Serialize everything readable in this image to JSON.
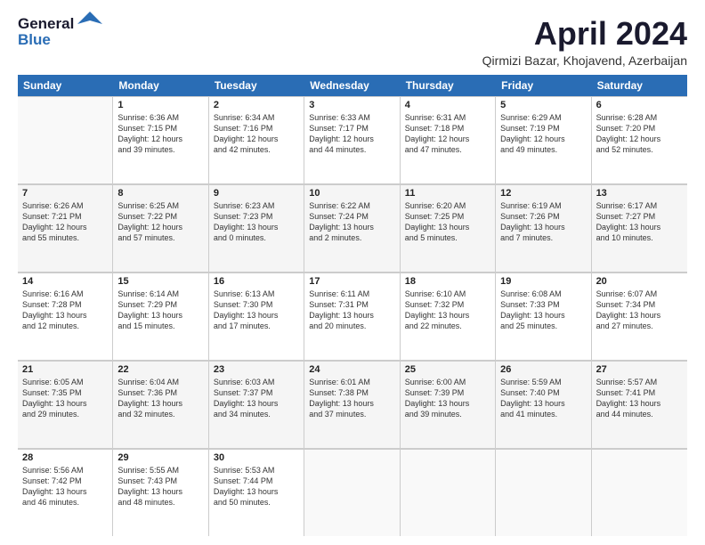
{
  "logo": {
    "line1": "General",
    "line2": "Blue"
  },
  "title": "April 2024",
  "location": "Qirmizi Bazar, Khojavend, Azerbaijan",
  "weekdays": [
    "Sunday",
    "Monday",
    "Tuesday",
    "Wednesday",
    "Thursday",
    "Friday",
    "Saturday"
  ],
  "rows": [
    [
      {
        "day": "",
        "lines": [],
        "empty": true
      },
      {
        "day": "1",
        "lines": [
          "Sunrise: 6:36 AM",
          "Sunset: 7:15 PM",
          "Daylight: 12 hours",
          "and 39 minutes."
        ]
      },
      {
        "day": "2",
        "lines": [
          "Sunrise: 6:34 AM",
          "Sunset: 7:16 PM",
          "Daylight: 12 hours",
          "and 42 minutes."
        ]
      },
      {
        "day": "3",
        "lines": [
          "Sunrise: 6:33 AM",
          "Sunset: 7:17 PM",
          "Daylight: 12 hours",
          "and 44 minutes."
        ]
      },
      {
        "day": "4",
        "lines": [
          "Sunrise: 6:31 AM",
          "Sunset: 7:18 PM",
          "Daylight: 12 hours",
          "and 47 minutes."
        ]
      },
      {
        "day": "5",
        "lines": [
          "Sunrise: 6:29 AM",
          "Sunset: 7:19 PM",
          "Daylight: 12 hours",
          "and 49 minutes."
        ]
      },
      {
        "day": "6",
        "lines": [
          "Sunrise: 6:28 AM",
          "Sunset: 7:20 PM",
          "Daylight: 12 hours",
          "and 52 minutes."
        ]
      }
    ],
    [
      {
        "day": "7",
        "lines": [
          "Sunrise: 6:26 AM",
          "Sunset: 7:21 PM",
          "Daylight: 12 hours",
          "and 55 minutes."
        ]
      },
      {
        "day": "8",
        "lines": [
          "Sunrise: 6:25 AM",
          "Sunset: 7:22 PM",
          "Daylight: 12 hours",
          "and 57 minutes."
        ]
      },
      {
        "day": "9",
        "lines": [
          "Sunrise: 6:23 AM",
          "Sunset: 7:23 PM",
          "Daylight: 13 hours",
          "and 0 minutes."
        ]
      },
      {
        "day": "10",
        "lines": [
          "Sunrise: 6:22 AM",
          "Sunset: 7:24 PM",
          "Daylight: 13 hours",
          "and 2 minutes."
        ]
      },
      {
        "day": "11",
        "lines": [
          "Sunrise: 6:20 AM",
          "Sunset: 7:25 PM",
          "Daylight: 13 hours",
          "and 5 minutes."
        ]
      },
      {
        "day": "12",
        "lines": [
          "Sunrise: 6:19 AM",
          "Sunset: 7:26 PM",
          "Daylight: 13 hours",
          "and 7 minutes."
        ]
      },
      {
        "day": "13",
        "lines": [
          "Sunrise: 6:17 AM",
          "Sunset: 7:27 PM",
          "Daylight: 13 hours",
          "and 10 minutes."
        ]
      }
    ],
    [
      {
        "day": "14",
        "lines": [
          "Sunrise: 6:16 AM",
          "Sunset: 7:28 PM",
          "Daylight: 13 hours",
          "and 12 minutes."
        ]
      },
      {
        "day": "15",
        "lines": [
          "Sunrise: 6:14 AM",
          "Sunset: 7:29 PM",
          "Daylight: 13 hours",
          "and 15 minutes."
        ]
      },
      {
        "day": "16",
        "lines": [
          "Sunrise: 6:13 AM",
          "Sunset: 7:30 PM",
          "Daylight: 13 hours",
          "and 17 minutes."
        ]
      },
      {
        "day": "17",
        "lines": [
          "Sunrise: 6:11 AM",
          "Sunset: 7:31 PM",
          "Daylight: 13 hours",
          "and 20 minutes."
        ]
      },
      {
        "day": "18",
        "lines": [
          "Sunrise: 6:10 AM",
          "Sunset: 7:32 PM",
          "Daylight: 13 hours",
          "and 22 minutes."
        ]
      },
      {
        "day": "19",
        "lines": [
          "Sunrise: 6:08 AM",
          "Sunset: 7:33 PM",
          "Daylight: 13 hours",
          "and 25 minutes."
        ]
      },
      {
        "day": "20",
        "lines": [
          "Sunrise: 6:07 AM",
          "Sunset: 7:34 PM",
          "Daylight: 13 hours",
          "and 27 minutes."
        ]
      }
    ],
    [
      {
        "day": "21",
        "lines": [
          "Sunrise: 6:05 AM",
          "Sunset: 7:35 PM",
          "Daylight: 13 hours",
          "and 29 minutes."
        ]
      },
      {
        "day": "22",
        "lines": [
          "Sunrise: 6:04 AM",
          "Sunset: 7:36 PM",
          "Daylight: 13 hours",
          "and 32 minutes."
        ]
      },
      {
        "day": "23",
        "lines": [
          "Sunrise: 6:03 AM",
          "Sunset: 7:37 PM",
          "Daylight: 13 hours",
          "and 34 minutes."
        ]
      },
      {
        "day": "24",
        "lines": [
          "Sunrise: 6:01 AM",
          "Sunset: 7:38 PM",
          "Daylight: 13 hours",
          "and 37 minutes."
        ]
      },
      {
        "day": "25",
        "lines": [
          "Sunrise: 6:00 AM",
          "Sunset: 7:39 PM",
          "Daylight: 13 hours",
          "and 39 minutes."
        ]
      },
      {
        "day": "26",
        "lines": [
          "Sunrise: 5:59 AM",
          "Sunset: 7:40 PM",
          "Daylight: 13 hours",
          "and 41 minutes."
        ]
      },
      {
        "day": "27",
        "lines": [
          "Sunrise: 5:57 AM",
          "Sunset: 7:41 PM",
          "Daylight: 13 hours",
          "and 44 minutes."
        ]
      }
    ],
    [
      {
        "day": "28",
        "lines": [
          "Sunrise: 5:56 AM",
          "Sunset: 7:42 PM",
          "Daylight: 13 hours",
          "and 46 minutes."
        ]
      },
      {
        "day": "29",
        "lines": [
          "Sunrise: 5:55 AM",
          "Sunset: 7:43 PM",
          "Daylight: 13 hours",
          "and 48 minutes."
        ]
      },
      {
        "day": "30",
        "lines": [
          "Sunrise: 5:53 AM",
          "Sunset: 7:44 PM",
          "Daylight: 13 hours",
          "and 50 minutes."
        ]
      },
      {
        "day": "",
        "lines": [],
        "empty": true
      },
      {
        "day": "",
        "lines": [],
        "empty": true
      },
      {
        "day": "",
        "lines": [],
        "empty": true
      },
      {
        "day": "",
        "lines": [],
        "empty": true
      }
    ]
  ]
}
